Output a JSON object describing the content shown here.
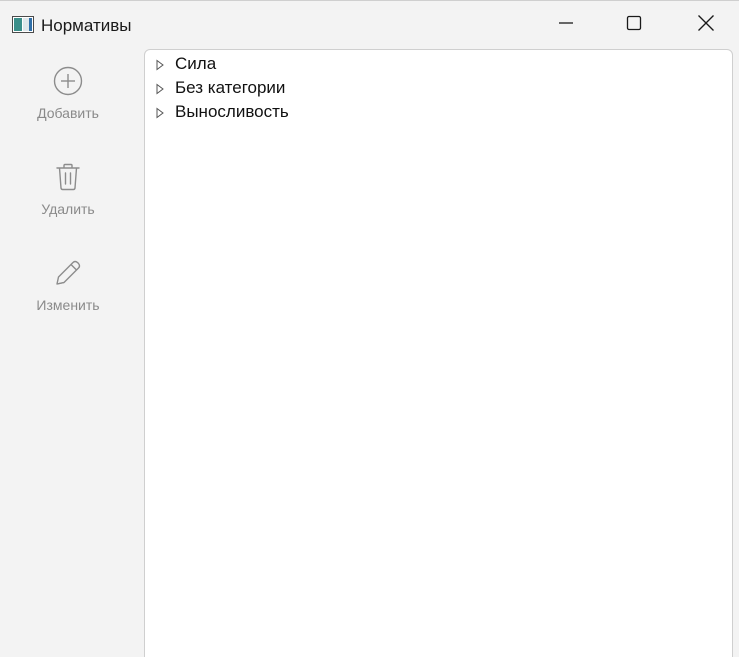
{
  "window": {
    "title": "Нормативы",
    "controls": {
      "minimize_icon": "minimize-icon",
      "maximize_icon": "maximize-icon",
      "close_icon": "close-icon"
    }
  },
  "sidebar": {
    "items": [
      {
        "label": "Добавить",
        "icon": "plus-circle-icon"
      },
      {
        "label": "Удалить",
        "icon": "trash-icon"
      },
      {
        "label": "Изменить",
        "icon": "pencil-icon"
      }
    ]
  },
  "tree": {
    "items": [
      {
        "label": "Сила",
        "expanded": false
      },
      {
        "label": "Без категории",
        "expanded": false
      },
      {
        "label": "Выносливость",
        "expanded": false
      }
    ]
  },
  "colors": {
    "background": "#f3f3f3",
    "panel": "#ffffff",
    "border": "#cfcfcf",
    "disabled_text": "#8a8a8a",
    "icon_gray": "#8c8c8c"
  }
}
